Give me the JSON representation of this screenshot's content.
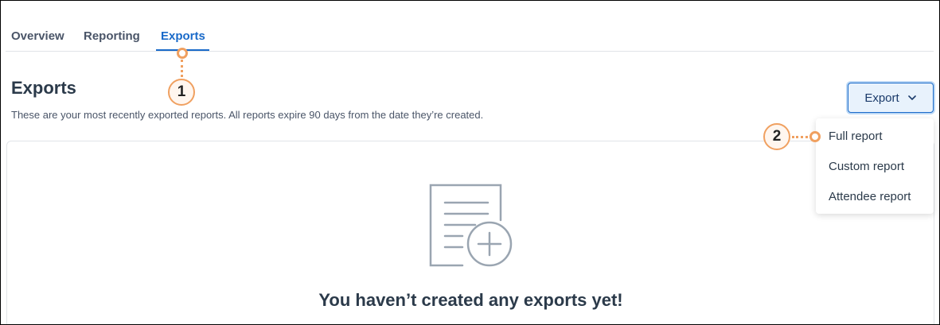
{
  "tabs": [
    {
      "label": "Overview"
    },
    {
      "label": "Reporting"
    },
    {
      "label": "Exports"
    }
  ],
  "page": {
    "title": "Exports",
    "description": "These are your most recently exported reports. All reports expire 90 days from the date they’re created."
  },
  "export_button": {
    "label": "Export",
    "icon": "chevron-down-icon"
  },
  "export_menu": {
    "items": [
      {
        "label": "Full report"
      },
      {
        "label": "Custom report"
      },
      {
        "label": "Attendee report"
      }
    ]
  },
  "empty_state": {
    "icon": "document-add-icon",
    "title": "You haven’t created any exports yet!"
  },
  "callouts": [
    {
      "number": "1"
    },
    {
      "number": "2"
    }
  ],
  "colors": {
    "accent": "#1a6ac9",
    "callout": "#f0a060",
    "text": "#2b3a4a"
  }
}
